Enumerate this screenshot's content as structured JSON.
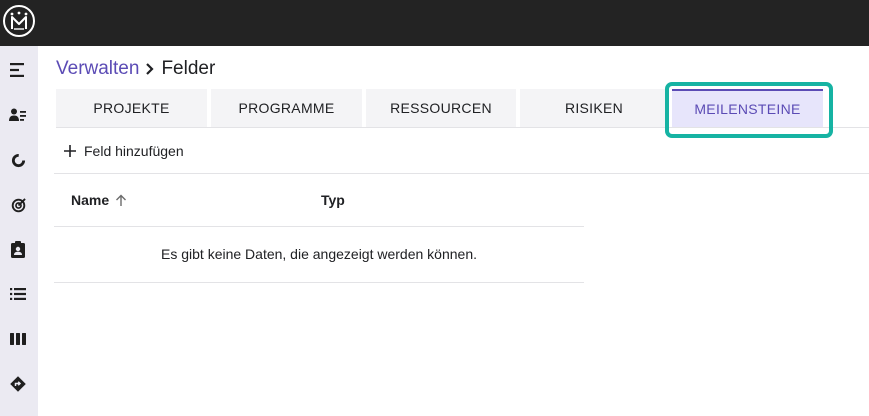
{
  "app": {
    "logo_icon": "crown-m-logo"
  },
  "sidebar": {
    "items": [
      {
        "icon": "menu-collapse-icon"
      },
      {
        "icon": "user-list-icon"
      },
      {
        "icon": "progress-circle-icon"
      },
      {
        "icon": "target-icon"
      },
      {
        "icon": "clipboard-user-icon"
      },
      {
        "icon": "list-icon"
      },
      {
        "icon": "columns-icon"
      },
      {
        "icon": "direction-sign-icon"
      }
    ]
  },
  "breadcrumb": {
    "parent": "Verwalten",
    "separator_icon": "chevron-right-icon",
    "current": "Felder"
  },
  "tabs": [
    {
      "label": "PROJEKTE",
      "active": false
    },
    {
      "label": "PROGRAMME",
      "active": false
    },
    {
      "label": "RESSOURCEN",
      "active": false
    },
    {
      "label": "RISIKEN",
      "active": false
    },
    {
      "label": "MEILENSTEINE",
      "active": true
    }
  ],
  "toolbar": {
    "add_field_label": "Feld hinzufügen",
    "add_icon": "plus-icon"
  },
  "table": {
    "columns": [
      {
        "label": "Name",
        "sort": "ascending"
      },
      {
        "label": "Typ"
      }
    ],
    "empty_message": "Es gibt keine Daten, die angezeigt werden können."
  },
  "colors": {
    "topbar": "#232323",
    "sidebar": "#ebeaf2",
    "accent": "#5b4bb5",
    "active_tab_bg": "#e7e5fb",
    "highlight": "#16b3a3"
  }
}
